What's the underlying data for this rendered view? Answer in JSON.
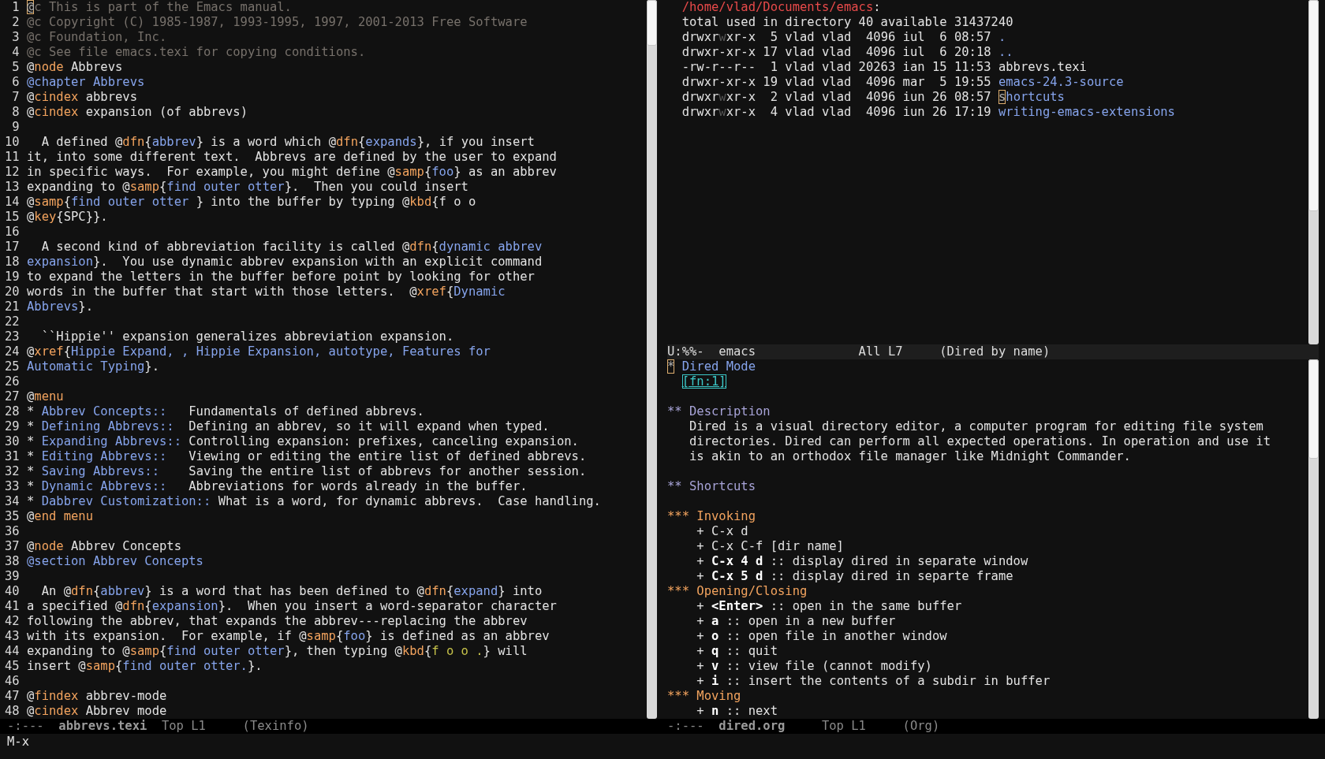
{
  "left_window": {
    "buffer_lines": [
      {
        "number": "1",
        "segments": [
          {
            "text": "@",
            "kind": "cursor"
          },
          {
            "text": "c This is part of the Emacs manual.",
            "kind": "comment"
          }
        ]
      },
      {
        "number": "2",
        "segments": [
          {
            "text": "@c Copyright (C) 1985-1987, 1993-1995, 1997, 2001-2013 Free Software",
            "kind": "comment"
          }
        ]
      },
      {
        "number": "3",
        "segments": [
          {
            "text": "@c Foundation, Inc.",
            "kind": "comment"
          }
        ]
      },
      {
        "number": "4",
        "segments": [
          {
            "text": "@c See file emacs.texi for copying conditions.",
            "kind": "comment"
          }
        ]
      },
      {
        "number": "5",
        "segments": [
          {
            "text": "@",
            "kind": "plain"
          },
          {
            "text": "node",
            "kind": "keyword"
          },
          {
            "text": " Abbrevs",
            "kind": "plain"
          }
        ]
      },
      {
        "number": "6",
        "segments": [
          {
            "text": "@chapter Abbrevs",
            "kind": "link"
          }
        ]
      },
      {
        "number": "7",
        "segments": [
          {
            "text": "@",
            "kind": "plain"
          },
          {
            "text": "cindex",
            "kind": "keyword"
          },
          {
            "text": " abbrevs",
            "kind": "plain"
          }
        ]
      },
      {
        "number": "8",
        "segments": [
          {
            "text": "@",
            "kind": "plain"
          },
          {
            "text": "cindex",
            "kind": "keyword"
          },
          {
            "text": " expansion (of abbrevs)",
            "kind": "plain"
          }
        ]
      },
      {
        "number": "9"
      },
      {
        "number": "10",
        "segments": [
          {
            "text": "  A defined @",
            "kind": "plain"
          },
          {
            "text": "dfn",
            "kind": "keyword"
          },
          {
            "text": "{",
            "kind": "plain"
          },
          {
            "text": "abbrev",
            "kind": "link"
          },
          {
            "text": "} is a word which @",
            "kind": "plain"
          },
          {
            "text": "dfn",
            "kind": "keyword"
          },
          {
            "text": "{",
            "kind": "plain"
          },
          {
            "text": "expands",
            "kind": "link"
          },
          {
            "text": "}, if you insert",
            "kind": "plain"
          }
        ]
      },
      {
        "number": "11",
        "segments": [
          {
            "text": "it, into some different text.  Abbrevs are defined by the user to expand",
            "kind": "plain"
          }
        ]
      },
      {
        "number": "12",
        "segments": [
          {
            "text": "in specific ways.  For example, you might define @",
            "kind": "plain"
          },
          {
            "text": "samp",
            "kind": "keyword"
          },
          {
            "text": "{",
            "kind": "plain"
          },
          {
            "text": "foo",
            "kind": "link"
          },
          {
            "text": "} as an abbrev",
            "kind": "plain"
          }
        ]
      },
      {
        "number": "13",
        "segments": [
          {
            "text": "expanding to @",
            "kind": "plain"
          },
          {
            "text": "samp",
            "kind": "keyword"
          },
          {
            "text": "{",
            "kind": "plain"
          },
          {
            "text": "find outer otter",
            "kind": "link"
          },
          {
            "text": "}.  Then you could insert",
            "kind": "plain"
          }
        ]
      },
      {
        "number": "14",
        "segments": [
          {
            "text": "@",
            "kind": "plain"
          },
          {
            "text": "samp",
            "kind": "keyword"
          },
          {
            "text": "{",
            "kind": "plain"
          },
          {
            "text": "find outer otter ",
            "kind": "link"
          },
          {
            "text": "} into the buffer by typing @",
            "kind": "plain"
          },
          {
            "text": "kbd",
            "kind": "keyword"
          },
          {
            "text": "{f o o",
            "kind": "plain"
          }
        ]
      },
      {
        "number": "15",
        "segments": [
          {
            "text": "@",
            "kind": "plain"
          },
          {
            "text": "key",
            "kind": "keyword"
          },
          {
            "text": "{SPC}}.",
            "kind": "plain"
          }
        ]
      },
      {
        "number": "16"
      },
      {
        "number": "17",
        "segments": [
          {
            "text": "  A second kind of abbreviation facility is called @",
            "kind": "plain"
          },
          {
            "text": "dfn",
            "kind": "keyword"
          },
          {
            "text": "{",
            "kind": "plain"
          },
          {
            "text": "dynamic abbrev",
            "kind": "link"
          }
        ]
      },
      {
        "number": "18",
        "segments": [
          {
            "text": "expansion",
            "kind": "link"
          },
          {
            "text": "}.  You use dynamic abbrev expansion with an explicit command",
            "kind": "plain"
          }
        ]
      },
      {
        "number": "19",
        "segments": [
          {
            "text": "to expand the letters in the buffer before point by looking for other",
            "kind": "plain"
          }
        ]
      },
      {
        "number": "20",
        "segments": [
          {
            "text": "words in the buffer that start with those letters.  @",
            "kind": "plain"
          },
          {
            "text": "xref",
            "kind": "keyword"
          },
          {
            "text": "{",
            "kind": "plain"
          },
          {
            "text": "Dynamic",
            "kind": "link"
          }
        ]
      },
      {
        "number": "21",
        "segments": [
          {
            "text": "Abbrevs",
            "kind": "link"
          },
          {
            "text": "}.",
            "kind": "plain"
          }
        ]
      },
      {
        "number": "22"
      },
      {
        "number": "23",
        "segments": [
          {
            "text": "  ``Hippie'' expansion generalizes abbreviation expansion.",
            "kind": "plain"
          }
        ]
      },
      {
        "number": "24",
        "segments": [
          {
            "text": "@",
            "kind": "plain"
          },
          {
            "text": "xref",
            "kind": "keyword"
          },
          {
            "text": "{",
            "kind": "plain"
          },
          {
            "text": "Hippie Expand, , Hippie Expansion, autotype, Features for",
            "kind": "link"
          }
        ]
      },
      {
        "number": "25",
        "segments": [
          {
            "text": "Automatic Typing",
            "kind": "link"
          },
          {
            "text": "}.",
            "kind": "plain"
          }
        ]
      },
      {
        "number": "26"
      },
      {
        "number": "27",
        "segments": [
          {
            "text": "@",
            "kind": "plain"
          },
          {
            "text": "menu",
            "kind": "keyword"
          }
        ]
      },
      {
        "number": "28",
        "segments": [
          {
            "text": "* ",
            "kind": "plain"
          },
          {
            "text": "Abbrev Concepts::",
            "kind": "link"
          },
          {
            "text": "   Fundamentals of defined abbrevs.",
            "kind": "plain"
          }
        ]
      },
      {
        "number": "29",
        "segments": [
          {
            "text": "* ",
            "kind": "plain"
          },
          {
            "text": "Defining Abbrevs::",
            "kind": "link"
          },
          {
            "text": "  Defining an abbrev, so it will expand when typed.",
            "kind": "plain"
          }
        ]
      },
      {
        "number": "30",
        "segments": [
          {
            "text": "* ",
            "kind": "plain"
          },
          {
            "text": "Expanding Abbrevs::",
            "kind": "link"
          },
          {
            "text": " Controlling expansion: prefixes, canceling expansion.",
            "kind": "plain"
          }
        ]
      },
      {
        "number": "31",
        "segments": [
          {
            "text": "* ",
            "kind": "plain"
          },
          {
            "text": "Editing Abbrevs::",
            "kind": "link"
          },
          {
            "text": "   Viewing or editing the entire list of defined abbrevs.",
            "kind": "plain"
          }
        ]
      },
      {
        "number": "32",
        "segments": [
          {
            "text": "* ",
            "kind": "plain"
          },
          {
            "text": "Saving Abbrevs::",
            "kind": "link"
          },
          {
            "text": "    Saving the entire list of abbrevs for another session.",
            "kind": "plain"
          }
        ]
      },
      {
        "number": "33",
        "segments": [
          {
            "text": "* ",
            "kind": "plain"
          },
          {
            "text": "Dynamic Abbrevs::",
            "kind": "link"
          },
          {
            "text": "   Abbreviations for words already in the buffer.",
            "kind": "plain"
          }
        ]
      },
      {
        "number": "34",
        "segments": [
          {
            "text": "* ",
            "kind": "plain"
          },
          {
            "text": "Dabbrev Customization::",
            "kind": "link"
          },
          {
            "text": " What is a word, for dynamic abbrevs.  Case handling.",
            "kind": "plain"
          }
        ]
      },
      {
        "number": "35",
        "segments": [
          {
            "text": "@",
            "kind": "plain"
          },
          {
            "text": "end menu",
            "kind": "keyword"
          }
        ]
      },
      {
        "number": "36"
      },
      {
        "number": "37",
        "segments": [
          {
            "text": "@",
            "kind": "plain"
          },
          {
            "text": "node",
            "kind": "keyword"
          },
          {
            "text": " Abbrev Concepts",
            "kind": "plain"
          }
        ]
      },
      {
        "number": "38",
        "segments": [
          {
            "text": "@section Abbrev Concepts",
            "kind": "link"
          }
        ]
      },
      {
        "number": "39"
      },
      {
        "number": "40",
        "segments": [
          {
            "text": "  An @",
            "kind": "plain"
          },
          {
            "text": "dfn",
            "kind": "keyword"
          },
          {
            "text": "{",
            "kind": "plain"
          },
          {
            "text": "abbrev",
            "kind": "link"
          },
          {
            "text": "} is a word that has been defined to @",
            "kind": "plain"
          },
          {
            "text": "dfn",
            "kind": "keyword"
          },
          {
            "text": "{",
            "kind": "plain"
          },
          {
            "text": "expand",
            "kind": "link"
          },
          {
            "text": "} into",
            "kind": "plain"
          }
        ]
      },
      {
        "number": "41",
        "segments": [
          {
            "text": "a specified @",
            "kind": "plain"
          },
          {
            "text": "dfn",
            "kind": "keyword"
          },
          {
            "text": "{",
            "kind": "plain"
          },
          {
            "text": "expansion",
            "kind": "link"
          },
          {
            "text": "}.  When you insert a word-separator character",
            "kind": "plain"
          }
        ]
      },
      {
        "number": "42",
        "segments": [
          {
            "text": "following the abbrev, that expands the abbrev---replacing the abbrev",
            "kind": "plain"
          }
        ]
      },
      {
        "number": "43",
        "segments": [
          {
            "text": "with its expansion.  For example, if @",
            "kind": "plain"
          },
          {
            "text": "samp",
            "kind": "keyword"
          },
          {
            "text": "{",
            "kind": "plain"
          },
          {
            "text": "foo",
            "kind": "link"
          },
          {
            "text": "} is defined as an abbrev",
            "kind": "plain"
          }
        ]
      },
      {
        "number": "44",
        "segments": [
          {
            "text": "expanding to @",
            "kind": "plain"
          },
          {
            "text": "samp",
            "kind": "keyword"
          },
          {
            "text": "{",
            "kind": "plain"
          },
          {
            "text": "find outer otter",
            "kind": "link"
          },
          {
            "text": "}, then typing @",
            "kind": "plain"
          },
          {
            "text": "kbd",
            "kind": "keyword"
          },
          {
            "text": "{",
            "kind": "plain"
          },
          {
            "text": "f o o .",
            "kind": "argument"
          },
          {
            "text": "} will",
            "kind": "plain"
          }
        ]
      },
      {
        "number": "45",
        "segments": [
          {
            "text": "insert @",
            "kind": "plain"
          },
          {
            "text": "samp",
            "kind": "keyword"
          },
          {
            "text": "{",
            "kind": "plain"
          },
          {
            "text": "find outer otter.",
            "kind": "link"
          },
          {
            "text": "}.",
            "kind": "plain"
          }
        ]
      },
      {
        "number": "46"
      },
      {
        "number": "47",
        "segments": [
          {
            "text": "@",
            "kind": "plain"
          },
          {
            "text": "findex",
            "kind": "keyword"
          },
          {
            "text": " abbrev-mode",
            "kind": "plain"
          }
        ]
      },
      {
        "number": "48",
        "segments": [
          {
            "text": "@",
            "kind": "plain"
          },
          {
            "text": "cindex",
            "kind": "keyword"
          },
          {
            "text": " Abbrev mode",
            "kind": "plain"
          }
        ]
      }
    ],
    "mode_line": {
      "active": false,
      "parts": [
        {
          "text": "-:---",
          "kind": "state"
        },
        {
          "text": "abbrevs.texi",
          "kind": "buffer"
        },
        {
          "text": "Top L1",
          "kind": "position"
        },
        {
          "text": "(Texinfo)",
          "kind": "mode"
        }
      ]
    }
  },
  "dired_window": {
    "lines": [
      {
        "segments": [
          {
            "text": "/home/vlad/Documents/emacs",
            "kind": "path"
          },
          {
            "text": ":",
            "kind": "plain"
          }
        ]
      },
      {
        "segments": [
          {
            "text": "total used in directory 40 available 31437240",
            "kind": "plain"
          }
        ]
      },
      {
        "segments": [
          {
            "text": "drwxr",
            "kind": "plain"
          },
          {
            "text": "w",
            "kind": "dim"
          },
          {
            "text": "xr-x  5 vlad vlad  4096 iul  6 08:57 ",
            "kind": "plain"
          },
          {
            "text": ".",
            "kind": "link"
          }
        ]
      },
      {
        "segments": [
          {
            "text": "drwxr-xr-x 17 vlad vlad  4096 iul  6 20:18 ",
            "kind": "plain"
          },
          {
            "text": "..",
            "kind": "link"
          }
        ]
      },
      {
        "segments": [
          {
            "text": "-rw-r--r--  1 vlad vlad 20263 ian 15 11:53 abbrevs.texi",
            "kind": "plain"
          }
        ]
      },
      {
        "segments": [
          {
            "text": "drwxr-xr-x 19 vlad vlad  4096 mar  5 19:55 ",
            "kind": "plain"
          },
          {
            "text": "emacs-24.3-source",
            "kind": "link"
          }
        ]
      },
      {
        "segments": [
          {
            "text": "drwxr",
            "kind": "plain"
          },
          {
            "text": "w",
            "kind": "dim"
          },
          {
            "text": "xr-x  2 vlad vlad  4096 iun 26 08:57 ",
            "kind": "plain"
          },
          {
            "text": "s",
            "kind": "cursor"
          },
          {
            "text": "hortcuts",
            "kind": "link"
          }
        ]
      },
      {
        "segments": [
          {
            "text": "drwxr",
            "kind": "plain"
          },
          {
            "text": "w",
            "kind": "dim"
          },
          {
            "text": "xr-x  4 vlad vlad  4096 iun 26 17:19 ",
            "kind": "plain"
          },
          {
            "text": "writing-emacs-extensions",
            "kind": "link"
          }
        ]
      }
    ],
    "mode_line": {
      "active": true,
      "parts": [
        {
          "text": "U:%%-",
          "kind": "state"
        },
        {
          "text": "emacs",
          "kind": "buffer"
        },
        {
          "text": "All L7",
          "kind": "position"
        },
        {
          "text": "(Dired by name)",
          "kind": "mode"
        }
      ]
    }
  },
  "org_window": {
    "lines": [
      {
        "kind": "heading",
        "segments": [
          {
            "text": "*",
            "kind": "cursor"
          },
          {
            "text": " Dired Mode",
            "kind": "heading1"
          }
        ]
      },
      {
        "kind": "footnote",
        "segments": [
          {
            "text": "[fn:1]",
            "kind": "footnote"
          }
        ]
      },
      {
        "kind": "blank"
      },
      {
        "kind": "heading",
        "segments": [
          {
            "text": "** Description",
            "kind": "heading2"
          }
        ]
      },
      {
        "kind": "body",
        "segments": [
          {
            "text": "Dired is a visual directory editor, a computer program for editing file system",
            "kind": "plain"
          }
        ]
      },
      {
        "kind": "body",
        "segments": [
          {
            "text": "directories. Dired can perform all expected operations. In operation and use it",
            "kind": "plain"
          }
        ]
      },
      {
        "kind": "body",
        "segments": [
          {
            "text": "is akin to an orthodox file manager like Midnight Commander.",
            "kind": "plain"
          }
        ]
      },
      {
        "kind": "blank"
      },
      {
        "kind": "heading",
        "segments": [
          {
            "text": "** Shortcuts",
            "kind": "heading2"
          }
        ]
      },
      {
        "kind": "blank"
      },
      {
        "kind": "heading",
        "segments": [
          {
            "text": "*** Invoking",
            "kind": "heading3"
          }
        ]
      },
      {
        "kind": "item",
        "segments": [
          {
            "text": "+ C-x d",
            "kind": "plain"
          }
        ]
      },
      {
        "kind": "item",
        "segments": [
          {
            "text": "+ C-x C-f [dir name]",
            "kind": "plain"
          }
        ]
      },
      {
        "kind": "item",
        "segments": [
          {
            "text": "+ ",
            "kind": "plain"
          },
          {
            "text": "C-x 4 d",
            "kind": "bold"
          },
          {
            "text": " :: display dired in separate window",
            "kind": "plain"
          }
        ]
      },
      {
        "kind": "item",
        "segments": [
          {
            "text": "+ ",
            "kind": "plain"
          },
          {
            "text": "C-x 5 d",
            "kind": "bold"
          },
          {
            "text": " :: display dired in separte frame",
            "kind": "plain"
          }
        ]
      },
      {
        "kind": "heading",
        "segments": [
          {
            "text": "*** Opening/Closing",
            "kind": "heading3"
          }
        ]
      },
      {
        "kind": "item",
        "segments": [
          {
            "text": "+ ",
            "kind": "plain"
          },
          {
            "text": "<Enter>",
            "kind": "bold"
          },
          {
            "text": " :: open in the same buffer",
            "kind": "plain"
          }
        ]
      },
      {
        "kind": "item",
        "segments": [
          {
            "text": "+ ",
            "kind": "plain"
          },
          {
            "text": "a",
            "kind": "bold"
          },
          {
            "text": " :: open in a new buffer",
            "kind": "plain"
          }
        ]
      },
      {
        "kind": "item",
        "segments": [
          {
            "text": "+ ",
            "kind": "plain"
          },
          {
            "text": "o",
            "kind": "bold"
          },
          {
            "text": " :: open file in another window",
            "kind": "plain"
          }
        ]
      },
      {
        "kind": "item",
        "segments": [
          {
            "text": "+ ",
            "kind": "plain"
          },
          {
            "text": "q",
            "kind": "bold"
          },
          {
            "text": " :: quit",
            "kind": "plain"
          }
        ]
      },
      {
        "kind": "item",
        "segments": [
          {
            "text": "+ ",
            "kind": "plain"
          },
          {
            "text": "v",
            "kind": "bold"
          },
          {
            "text": " :: view file (cannot modify)",
            "kind": "plain"
          }
        ]
      },
      {
        "kind": "item",
        "segments": [
          {
            "text": "+ ",
            "kind": "plain"
          },
          {
            "text": "i",
            "kind": "bold"
          },
          {
            "text": " :: insert the contents of a subdir in buffer",
            "kind": "plain"
          }
        ]
      },
      {
        "kind": "heading",
        "segments": [
          {
            "text": "*** Moving",
            "kind": "heading3"
          }
        ]
      },
      {
        "kind": "item",
        "segments": [
          {
            "text": "+ ",
            "kind": "plain"
          },
          {
            "text": "n",
            "kind": "bold"
          },
          {
            "text": " :: next",
            "kind": "plain"
          }
        ]
      }
    ],
    "mode_line": {
      "active": false,
      "parts": [
        {
          "text": "-:---",
          "kind": "state"
        },
        {
          "text": "dired.org",
          "kind": "buffer"
        },
        {
          "text": "Top L1",
          "kind": "position"
        },
        {
          "text": "(Org)",
          "kind": "mode"
        }
      ]
    }
  },
  "minibuffer": {
    "text": "M-x"
  }
}
